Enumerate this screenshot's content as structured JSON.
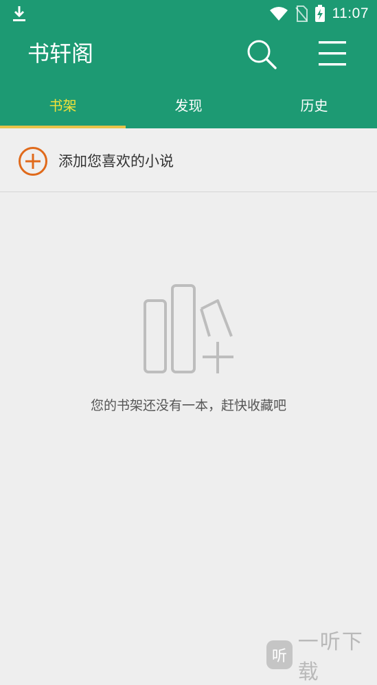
{
  "status_bar": {
    "time": "11:07",
    "icons": [
      "download-icon",
      "wifi-icon",
      "no-sim-icon",
      "battery-charging-icon"
    ]
  },
  "app_bar": {
    "title": "书轩阁",
    "icons": [
      "search-icon",
      "menu-icon"
    ]
  },
  "tabs": [
    {
      "label": "书架",
      "active": true
    },
    {
      "label": "发现",
      "active": false
    },
    {
      "label": "历史",
      "active": false
    }
  ],
  "add_novel": {
    "label": "添加您喜欢的小说",
    "icon": "add-circle-icon"
  },
  "empty_state": {
    "icon": "empty-bookshelf-icon",
    "message": "您的书架还没有一本，赶快收藏吧"
  },
  "watermark": {
    "badge": "听",
    "text": "一听下载"
  },
  "colors": {
    "primary": "#1d9a73",
    "active_tab": "#f3e23a",
    "indicator": "#e8c34a",
    "accent_add": "#e06a1b",
    "background": "#eeeeee"
  }
}
